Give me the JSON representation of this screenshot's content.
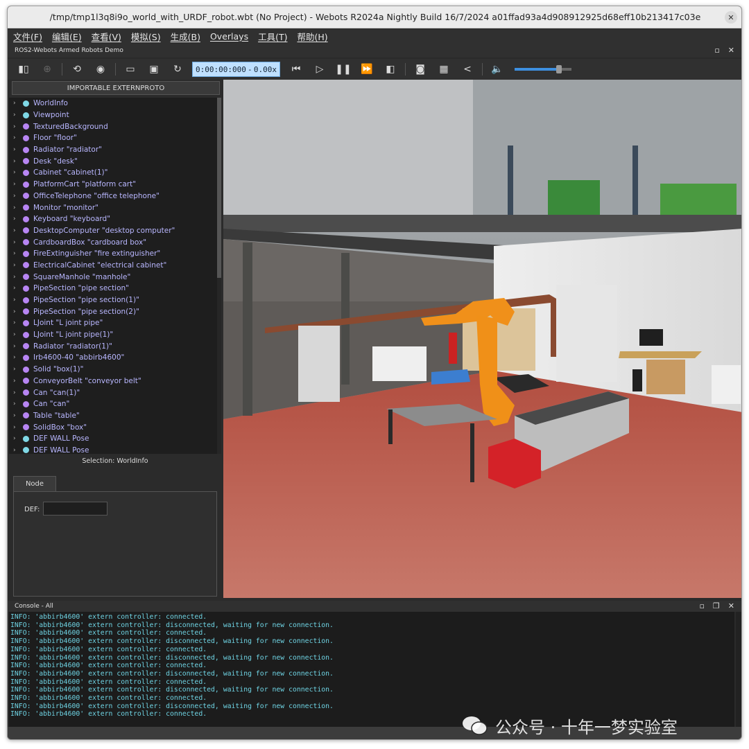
{
  "window": {
    "title": "/tmp/tmp1l3q8i9o_world_with_URDF_robot.wbt (No Project) - Webots R2024a Nightly Build 16/7/2024 a01ffad93a4d908912925d68eff10b213417c03e",
    "close_icon": "close-icon"
  },
  "menubar": {
    "items": [
      "文件(F)",
      "编辑(E)",
      "查看(V)",
      "模拟(S)",
      "生成(B)",
      "Overlays",
      "工具(T)",
      "帮助(H)"
    ]
  },
  "subtitle": "ROS2-Webots Armed Robots Demo",
  "toolbar": {
    "time": "0:00:00:000",
    "speed_prefix": "-",
    "speed": "0.00x",
    "icons": [
      "sidebar-toggle-icon",
      "add-node-icon",
      "reload-world-icon",
      "view-icon",
      "open-folder-icon",
      "save-icon",
      "reset-icon",
      "step-back-icon",
      "step-icon",
      "pause-icon",
      "fast-forward-icon",
      "cube-icon",
      "screenshot-icon",
      "record-icon",
      "share-icon",
      "volume-icon"
    ],
    "volume_fraction": 0.78
  },
  "scene_tree": {
    "import_button": "IMPORTABLE EXTERNPROTO",
    "nodes": [
      {
        "label": "WorldInfo",
        "color": "#7fd8e6"
      },
      {
        "label": "Viewpoint",
        "color": "#7fd8e6"
      },
      {
        "label": "TexturedBackground",
        "color": "#b785f3"
      },
      {
        "label": "Floor \"floor\"",
        "color": "#b785f3"
      },
      {
        "label": "Radiator \"radiator\"",
        "color": "#b785f3"
      },
      {
        "label": "Desk \"desk\"",
        "color": "#b785f3"
      },
      {
        "label": "Cabinet \"cabinet(1)\"",
        "color": "#b785f3"
      },
      {
        "label": "PlatformCart \"platform cart\"",
        "color": "#b785f3"
      },
      {
        "label": "OfficeTelephone \"office telephone\"",
        "color": "#b785f3"
      },
      {
        "label": "Monitor \"monitor\"",
        "color": "#b785f3"
      },
      {
        "label": "Keyboard \"keyboard\"",
        "color": "#b785f3"
      },
      {
        "label": "DesktopComputer \"desktop computer\"",
        "color": "#b785f3"
      },
      {
        "label": "CardboardBox \"cardboard box\"",
        "color": "#b785f3"
      },
      {
        "label": "FireExtinguisher \"fire extinguisher\"",
        "color": "#b785f3"
      },
      {
        "label": "ElectricalCabinet \"electrical cabinet\"",
        "color": "#b785f3"
      },
      {
        "label": "SquareManhole \"manhole\"",
        "color": "#b785f3"
      },
      {
        "label": "PipeSection \"pipe section\"",
        "color": "#b785f3"
      },
      {
        "label": "PipeSection \"pipe section(1)\"",
        "color": "#b785f3"
      },
      {
        "label": "PipeSection \"pipe section(2)\"",
        "color": "#b785f3"
      },
      {
        "label": "LJoint \"L joint pipe\"",
        "color": "#b785f3"
      },
      {
        "label": "LJoint \"L joint pipe(1)\"",
        "color": "#b785f3"
      },
      {
        "label": "Radiator \"radiator(1)\"",
        "color": "#b785f3"
      },
      {
        "label": "Irb4600-40 \"abbirb4600\"",
        "color": "#b785f3"
      },
      {
        "label": "Solid \"box(1)\"",
        "color": "#b785f3"
      },
      {
        "label": "ConveyorBelt \"conveyor belt\"",
        "color": "#b785f3"
      },
      {
        "label": "Can \"can(1)\"",
        "color": "#b785f3"
      },
      {
        "label": "Can \"can\"",
        "color": "#b785f3"
      },
      {
        "label": "Table \"table\"",
        "color": "#b785f3"
      },
      {
        "label": "SolidBox \"box\"",
        "color": "#b785f3"
      },
      {
        "label": "DEF WALL Pose",
        "color": "#7fd8e6"
      },
      {
        "label": "DEF WALL Pose",
        "color": "#7fd8e6"
      }
    ]
  },
  "selection": "Selection: WorldInfo",
  "node_tab": "Node",
  "def_label": "DEF:",
  "def_value": "",
  "console": {
    "title": "Console - All",
    "lines": [
      "INFO: 'abbirb4600' extern controller: connected.",
      "INFO: 'abbirb4600' extern controller: disconnected, waiting for new connection.",
      "INFO: 'abbirb4600' extern controller: connected.",
      "INFO: 'abbirb4600' extern controller: disconnected, waiting for new connection.",
      "INFO: 'abbirb4600' extern controller: connected.",
      "INFO: 'abbirb4600' extern controller: disconnected, waiting for new connection.",
      "INFO: 'abbirb4600' extern controller: connected.",
      "INFO: 'abbirb4600' extern controller: disconnected, waiting for new connection.",
      "INFO: 'abbirb4600' extern controller: connected.",
      "INFO: 'abbirb4600' extern controller: disconnected, waiting for new connection.",
      "INFO: 'abbirb4600' extern controller: connected.",
      "INFO: 'abbirb4600' extern controller: disconnected, waiting for new connection.",
      "INFO: 'abbirb4600' extern controller: connected."
    ]
  },
  "watermark": "公众号 · 十年一梦实验室"
}
